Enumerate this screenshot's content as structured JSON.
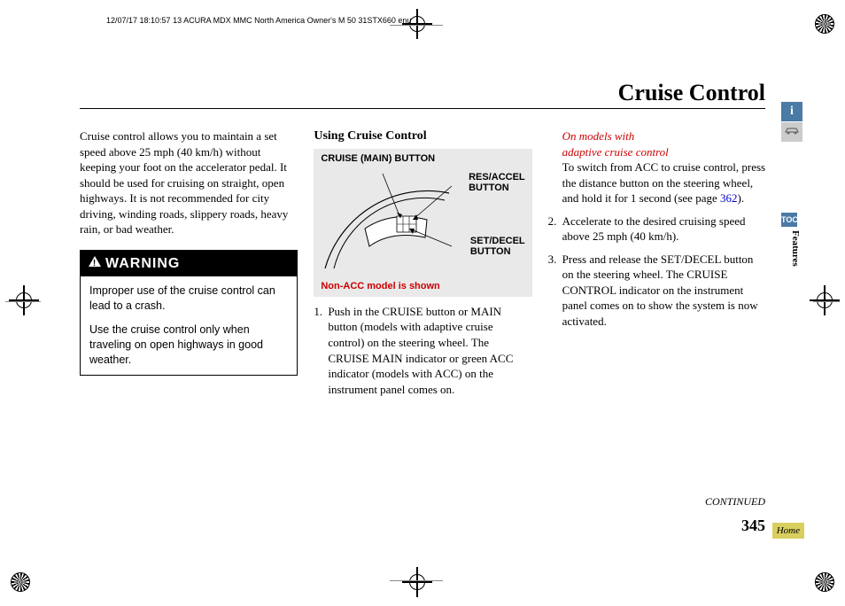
{
  "meta": {
    "header": "12/07/17 18:10:57   13 ACURA MDX MMC North America Owner's M 50 31STX660 enu"
  },
  "title": "Cruise Control",
  "col1": {
    "intro": "Cruise control allows you to maintain a set speed above 25 mph (40 km/h) without keeping your foot on the accelerator pedal. It should be used for cruising on straight, open highways. It is not recommended for city driving, winding roads, slippery roads, heavy rain, or bad weather.",
    "warning_label": "WARNING",
    "warning_p1": "Improper use of the cruise control can lead to a crash.",
    "warning_p2": "Use the cruise control only when traveling on open highways in good weather."
  },
  "col2": {
    "heading": "Using Cruise Control",
    "diagram": {
      "main": "CRUISE (MAIN) BUTTON",
      "res": "RES/ACCEL BUTTON",
      "set": "SET/DECEL BUTTON",
      "note": "Non-ACC model is shown"
    },
    "step1_num": "1.",
    "step1": "Push in the CRUISE button or MAIN button (models with adaptive cruise control) on the steering wheel. The CRUISE MAIN indicator or green ACC indicator (models with ACC) on the instrument panel comes on."
  },
  "col3": {
    "red1": "On models with",
    "red2": "adaptive cruise control",
    "p1a": "To switch from ACC to cruise control, press the distance button on the steering wheel, and hold it for 1 second (see page ",
    "p1link": "362",
    "p1b": ").",
    "step2_num": "2.",
    "step2": "Accelerate to the desired cruising speed above 25 mph (40 km/h).",
    "step3_num": "3.",
    "step3": "Press and release the SET/DECEL button on the steering wheel. The CRUISE CONTROL indicator on the instrument panel comes on to show the system is now activated."
  },
  "footer": {
    "continued": "CONTINUED",
    "page": "345"
  },
  "tabs": {
    "i": "i",
    "toc": "TOC",
    "features": "Features",
    "home": "Home"
  }
}
